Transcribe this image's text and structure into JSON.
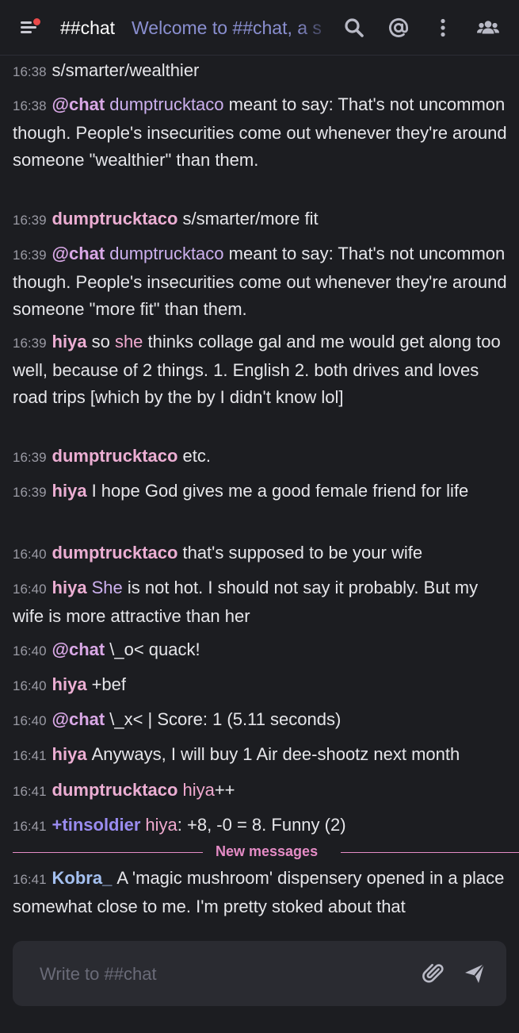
{
  "header": {
    "channel": "##chat",
    "topic": "Welcome to ##chat, a s"
  },
  "messages": [
    {
      "time": "16:38",
      "nick": "",
      "text": "s/smarter/wealthier"
    },
    {
      "time": "16:38",
      "nick": "@chat",
      "mention": "dumptrucktaco",
      "text": " meant to say: That's not uncommon though. People's insecurities come out whenever they're around someone \"wealthier\" than them."
    },
    {
      "time": "16:39",
      "nick": "dumptrucktaco",
      "text": "s/smarter/more fit"
    },
    {
      "time": "16:39",
      "nick": "@chat",
      "mention": "dumptrucktaco",
      "text": " meant to say: That's not uncommon though. People's insecurities come out whenever they're around someone \"more fit\" than them."
    },
    {
      "time": "16:39",
      "nick": "hiya",
      "pre": "so ",
      "mention": "she",
      "text": " thinks collage gal and me would get along too well, because of 2 things. 1. English 2. both drives and loves road trips [which by the by I didn't know lol]"
    },
    {
      "time": "16:39",
      "nick": "dumptrucktaco",
      "text": "etc."
    },
    {
      "time": "16:39",
      "nick": "hiya",
      "text": "I hope God gives me a good female friend  for life"
    },
    {
      "time": "16:40",
      "nick": "dumptrucktaco",
      "text": "that's supposed to be your wife"
    },
    {
      "time": "16:40",
      "nick": "hiya",
      "mention": "She",
      "text": " is not hot. I should not say it probably. But my wife is more attractive than her"
    },
    {
      "time": "16:40",
      "nick": "@chat",
      "text": "\\_o< quack!"
    },
    {
      "time": "16:40",
      "nick": "hiya",
      "text": "+bef"
    },
    {
      "time": "16:40",
      "nick": "@chat",
      "text": "\\_x< | Score: 1 (5.11 seconds)"
    },
    {
      "time": "16:41",
      "nick": "hiya",
      "text": "Anyways, I will buy 1 Air dee-shootz next month"
    },
    {
      "time": "16:41",
      "nick": "dumptrucktaco",
      "mention": "hiya",
      "text": "++"
    },
    {
      "time": "16:41",
      "nick": "+tinsoldier",
      "mention": "hiya",
      "text": ": +8, -0 = 8. Funny (2)"
    },
    {
      "time": "16:41",
      "nick": "Kobra_",
      "text": "A 'magic mushroom' dispensery opened in a place somewhat close to me. I'm pretty stoked about that"
    }
  ],
  "divider": {
    "label": "New messages"
  },
  "composer": {
    "placeholder": "Write to ##chat"
  },
  "icons": [
    "menu-icon",
    "search-icon",
    "mention-icon",
    "more-vertical-icon",
    "users-icon",
    "attach-icon",
    "send-icon"
  ],
  "colors": {
    "background": "#1c1d21",
    "nick": "#ecaed3",
    "bot": "#d9a8e6",
    "voice": "#9a8cf0",
    "divider": "#e58cc6",
    "topic": "#8a8fd0"
  }
}
